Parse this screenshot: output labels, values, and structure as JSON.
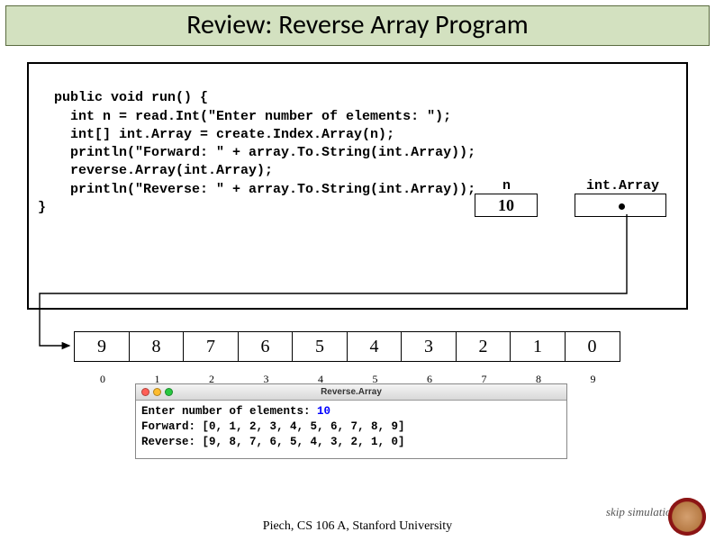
{
  "title": "Review: Reverse Array Program",
  "code": "public void run() {\n    int n = read.Int(\"Enter number of elements: \");\n    int[] int.Array = create.Index.Array(n);\n    println(\"Forward: \" + array.To.String(int.Array));\n    reverse.Array(int.Array);\n    println(\"Reverse: \" + array.To.String(int.Array));\n}",
  "vars": {
    "n_label": "n",
    "n_value": "10",
    "arr_label": "int.Array"
  },
  "array": {
    "values": [
      "9",
      "8",
      "7",
      "6",
      "5",
      "4",
      "3",
      "2",
      "1",
      "0"
    ],
    "indices": [
      "0",
      "1",
      "2",
      "3",
      "4",
      "5",
      "6",
      "7",
      "8",
      "9"
    ]
  },
  "console": {
    "title": "Reverse.Array",
    "line1_prefix": "Enter number of elements: ",
    "line1_input": "10",
    "line2": "Forward: [0, 1, 2, 3, 4, 5, 6, 7, 8, 9]",
    "line3": "Reverse: [9, 8, 7, 6, 5, 4, 3, 2, 1, 0]"
  },
  "footer": "Piech, CS 106 A, Stanford University",
  "skip": "skip simulation"
}
